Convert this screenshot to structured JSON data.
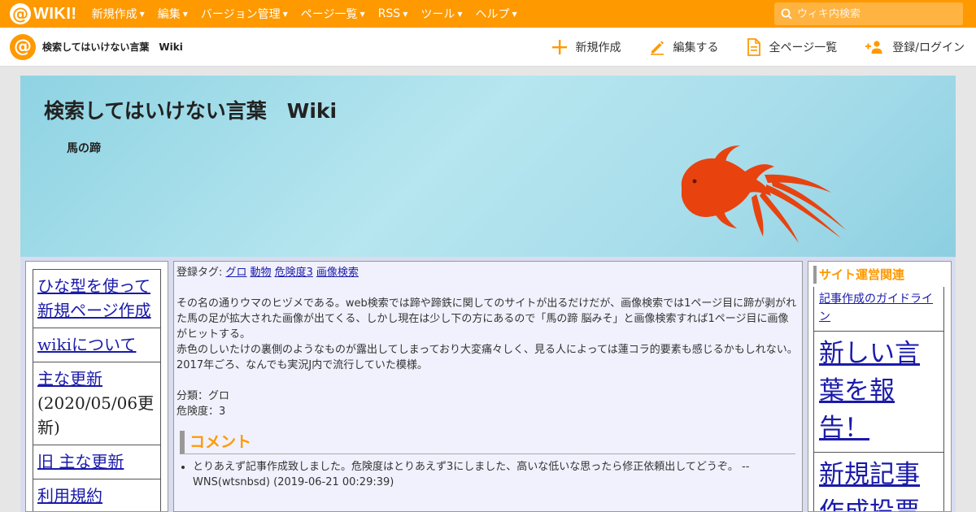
{
  "topbar": {
    "logo_text": "WIKI!",
    "nav": [
      "新規作成",
      "編集",
      "バージョン管理",
      "ページ一覧",
      "RSS",
      "ツール",
      "ヘルプ"
    ],
    "search_placeholder": "ウィキ内検索"
  },
  "subbar": {
    "site_title": "検索してはいけない言葉　Wiki",
    "actions": [
      {
        "label": "新規作成",
        "icon": "plus-icon"
      },
      {
        "label": "編集する",
        "icon": "pencil-icon"
      },
      {
        "label": "全ページ一覧",
        "icon": "document-icon"
      },
      {
        "label": "登録/ログイン",
        "icon": "user-add-icon"
      }
    ]
  },
  "banner": {
    "title": "検索してはいけない言葉　Wiki",
    "page_name": "馬の蹄"
  },
  "leftbar": {
    "items": [
      {
        "link": "ひな型を使って新規ページ作成",
        "note": ""
      },
      {
        "link": "wikiについて",
        "note": ""
      },
      {
        "link": "主な更新",
        "note": "(2020/05/06更新)"
      },
      {
        "link": "旧 主な更新",
        "note": ""
      },
      {
        "link": "利用規約",
        "note": ""
      }
    ]
  },
  "main": {
    "tags_label": "登録タグ:",
    "tags": [
      "グロ",
      "動物",
      "危険度3",
      "画像検索"
    ],
    "paragraphs": [
      "その名の通りウマのヒヅメである。web検索では蹄や蹄鉄に関してのサイトが出るだけだが、画像検索では1ページ目に蹄が剥がれた馬の足が拡大された画像が出てくる、しかし現在は少し下の方にあるので「馬の蹄 脳みそ」と画像検索すれば1ページ目に画像がヒットする。",
      "赤色のしいたけの裏側のようなものが露出してしまっており大変痛々しく、見る人によっては蓮コラ的要素も感じるかもしれない。",
      "2017年ごろ、なんでも実況J内で流行していた模様。"
    ],
    "category": "分類：グロ",
    "danger": "危険度：3",
    "comment_heading": "コメント",
    "comments": [
      "とりあえず記事作成致しました。危険度はとりあえず3にしました、高いな低いな思ったら修正依頼出してどうぞ。 -- WNS(wtsnbsd) (2019-06-21 00:29:39)"
    ]
  },
  "rightbar": {
    "heading": "サイト運営関連",
    "items": [
      {
        "label": "記事作成のガイドライン",
        "size": "small"
      },
      {
        "label": "新しい言葉を報告！",
        "size": "large"
      },
      {
        "label": "新規記事作成投票",
        "size": "large"
      }
    ]
  },
  "colors": {
    "brand": "#ff9900",
    "link": "#1a1aaa",
    "goldfish": "#e8420f"
  }
}
